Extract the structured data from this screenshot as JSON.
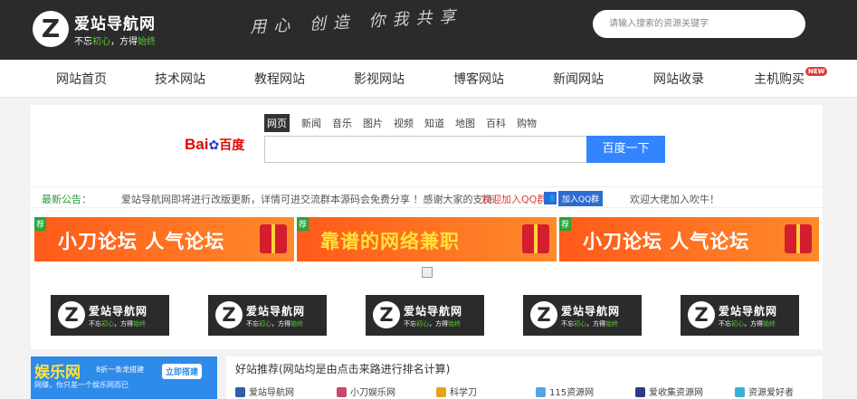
{
  "header": {
    "logo_letter": "Z",
    "logo_name": "爱站导航网",
    "logo_slogan_a": "不忘",
    "logo_slogan_b": "初心",
    "logo_slogan_c": "，方得",
    "logo_slogan_d": "始终",
    "motto": "用心 创造 你我共享",
    "search_placeholder": "请输入搜索的资源关键字"
  },
  "nav": {
    "items": [
      {
        "label": "网站首页"
      },
      {
        "label": "技术网站"
      },
      {
        "label": "教程网站"
      },
      {
        "label": "影视网站"
      },
      {
        "label": "博客网站"
      },
      {
        "label": "新闻网站"
      },
      {
        "label": "网站收录"
      },
      {
        "label": "主机购买"
      }
    ],
    "new_badge": "NEW"
  },
  "baidu": {
    "logo_a": "Bai",
    "logo_b": "百度",
    "tabs": [
      "网页",
      "新闻",
      "音乐",
      "图片",
      "视频",
      "知道",
      "地图",
      "百科",
      "购物"
    ],
    "button": "百度一下"
  },
  "notice": {
    "label": "最新公告：",
    "text": "爱站导航网即将进行改版更新，详情可进交流群本源码会免费分享 ！感谢大家的支持！",
    "link": "欢迎加入QQ群",
    "qq_button": "加入QQ群",
    "welcome": "欢迎大佬加入吹牛！"
  },
  "banners": [
    {
      "tag": "荐",
      "text": "小刀论坛 人气论坛"
    },
    {
      "tag": "荐",
      "text": "靠谱的网络兼职"
    },
    {
      "tag": "荐",
      "text": "小刀论坛 人气论坛"
    }
  ],
  "ad": {
    "title": "娱乐网",
    "tag": "8折一条龙搭建",
    "button": "立即搭建",
    "sub": "网赚，你只差一个娱乐网而已"
  },
  "goodsites": {
    "title": "好站推荐(网站均是由点击来路进行排名计算)",
    "items": [
      {
        "label": "爱站导航网",
        "color": "#2b5fa8"
      },
      {
        "label": "小刀娱乐网",
        "color": "#c84a6a"
      },
      {
        "label": "科学刀",
        "color": "#e8a21a"
      },
      {
        "label": "115资源网",
        "color": "#5aa2e8"
      },
      {
        "label": "爱收集资源网",
        "color": "#2b3a8a"
      },
      {
        "label": "资源爱好者",
        "color": "#3ab0d8"
      }
    ]
  }
}
